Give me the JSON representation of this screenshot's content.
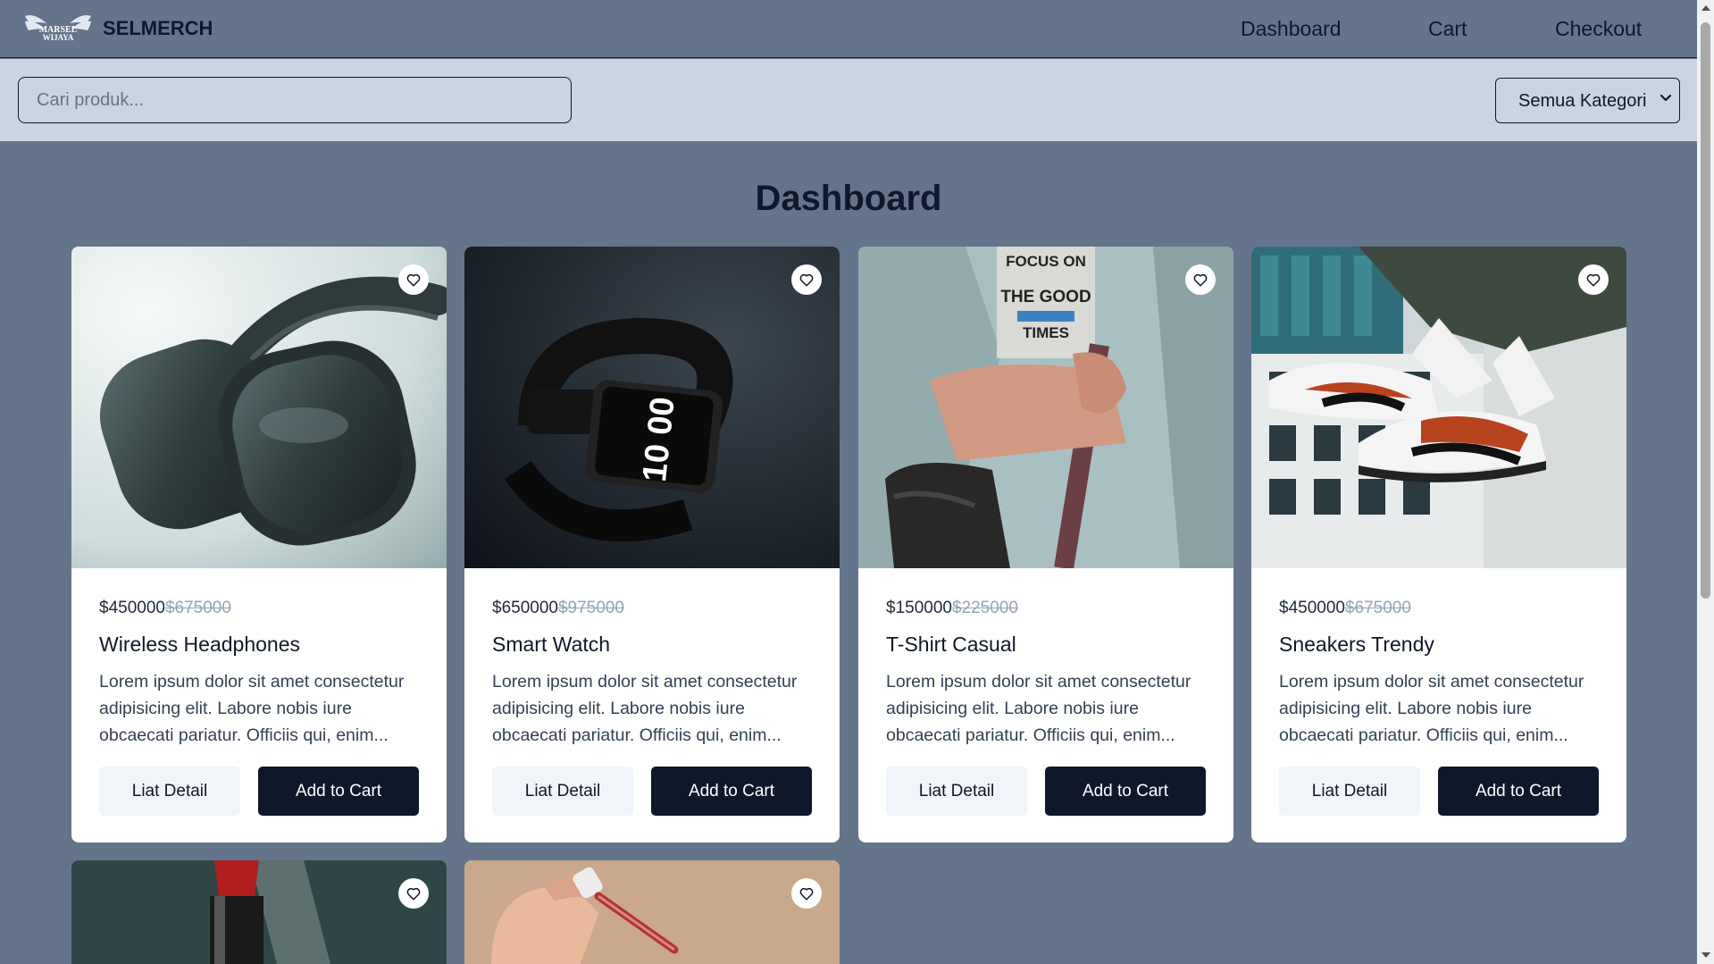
{
  "brand": {
    "name": "SELMERCH",
    "logo_text": "MARSEL WIJAYA"
  },
  "nav": {
    "dashboard": "Dashboard",
    "cart": "Cart",
    "checkout": "Checkout"
  },
  "filters": {
    "search_placeholder": "Cari produk...",
    "category_selected": "Semua Kategori"
  },
  "page": {
    "title": "Dashboard"
  },
  "products": [
    {
      "name": "Wireless Headphones",
      "price": "$450000",
      "old_price": "$675000",
      "description": "Lorem ipsum dolor sit amet consectetur adipisicing elit. Labore nobis iure obcaecati pariatur. Officiis qui, enim...",
      "detail_label": "Liat Detail",
      "cart_label": "Add to Cart",
      "image": "headphones"
    },
    {
      "name": "Smart Watch",
      "price": "$650000",
      "old_price": "$975000",
      "description": "Lorem ipsum dolor sit amet consectetur adipisicing elit. Labore nobis iure obcaecati pariatur. Officiis qui, enim...",
      "detail_label": "Liat Detail",
      "cart_label": "Add to Cart",
      "image": "smartwatch",
      "watch_face": "10 00"
    },
    {
      "name": "T-Shirt Casual",
      "price": "$150000",
      "old_price": "$225000",
      "description": "Lorem ipsum dolor sit amet consectetur adipisicing elit. Labore nobis iure obcaecati pariatur. Officiis qui, enim...",
      "detail_label": "Liat Detail",
      "cart_label": "Add to Cart",
      "image": "tshirt",
      "shirt_print": [
        "FOCUS ON",
        "THE GOOD",
        "TIMES"
      ]
    },
    {
      "name": "Sneakers Trendy",
      "price": "$450000",
      "old_price": "$675000",
      "description": "Lorem ipsum dolor sit amet consectetur adipisicing elit. Labore nobis iure obcaecati pariatur. Officiis qui, enim...",
      "detail_label": "Liat Detail",
      "cart_label": "Add to Cart",
      "image": "sneakers"
    },
    {
      "image": "lipstick"
    },
    {
      "image": "dropper"
    }
  ],
  "colors": {
    "page_bg": "#64748b",
    "filter_bg": "#cbd5e1",
    "primary_button": "#0f172a",
    "secondary_button": "#f1f5f9"
  },
  "icons": [
    "heart-icon",
    "chevron-down-icon",
    "logo-wings"
  ]
}
